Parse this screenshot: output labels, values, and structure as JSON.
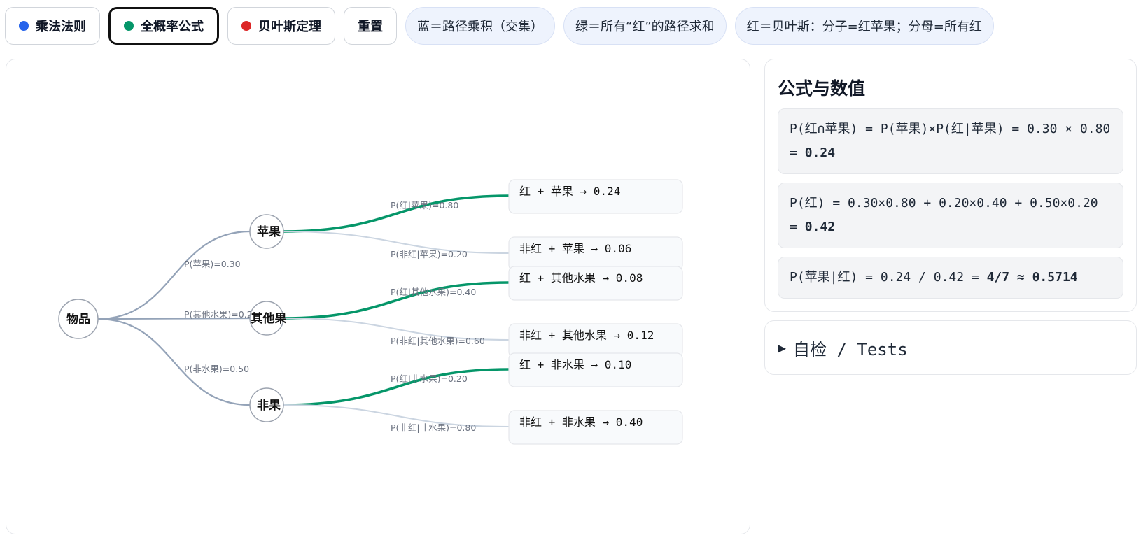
{
  "toolbar": {
    "buttons": [
      {
        "label": "乘法法则",
        "dot_color": "#2563eb"
      },
      {
        "label": "全概率公式",
        "dot_color": "#059669"
      },
      {
        "label": "贝叶斯定理",
        "dot_color": "#dc2626"
      },
      {
        "label": "重置"
      }
    ],
    "active": "全概率公式",
    "legend_pills": [
      "蓝＝路径乘积（交集）",
      "绿＝所有“红”的路径求和",
      "红＝贝叶斯：分子=红苹果；分母=所有红"
    ]
  },
  "tree": {
    "root": "物品",
    "branches": [
      {
        "node": "苹果",
        "edge_label": "P(苹果)=0.30",
        "children": [
          {
            "edge_label": "P(红|苹果)=0.80",
            "leaf": "红 + 苹果 → 0.24",
            "highlight": true
          },
          {
            "edge_label": "P(非红|苹果)=0.20",
            "leaf": "非红 + 苹果 → 0.06",
            "highlight": false
          }
        ]
      },
      {
        "node": "其他果",
        "edge_label": "P(其他水果)=0.20",
        "children": [
          {
            "edge_label": "P(红|其他水果)=0.40",
            "leaf": "红 + 其他水果 → 0.08",
            "highlight": true
          },
          {
            "edge_label": "P(非红|其他水果)=0.60",
            "leaf": "非红 + 其他水果 → 0.12",
            "highlight": false
          }
        ]
      },
      {
        "node": "非果",
        "edge_label": "P(非水果)=0.50",
        "children": [
          {
            "edge_label": "P(红|非水果)=0.20",
            "leaf": "红 + 非水果 → 0.10",
            "highlight": true
          },
          {
            "edge_label": "P(非红|非水果)=0.80",
            "leaf": "非红 + 非水果 → 0.40",
            "highlight": false
          }
        ]
      }
    ],
    "colors": {
      "highlight": "#059669",
      "trunk": "#94a3b8",
      "faded": "#cbd5e1"
    }
  },
  "formulas": {
    "title": "公式与数值",
    "items": [
      {
        "text": "P(红∩苹果) = P(苹果)×P(红|苹果) = 0.30 × 0.80 = ",
        "bold": "0.24"
      },
      {
        "text": "P(红) = 0.30×0.80 + 0.20×0.40 + 0.50×0.20 = ",
        "bold": "0.42"
      },
      {
        "text": "P(苹果|红) = 0.24 / 0.42 = ",
        "bold": "4/7 ≈ 0.5714"
      }
    ]
  },
  "tests": {
    "label": "自检 / Tests",
    "icon": "triangle-right-icon"
  }
}
